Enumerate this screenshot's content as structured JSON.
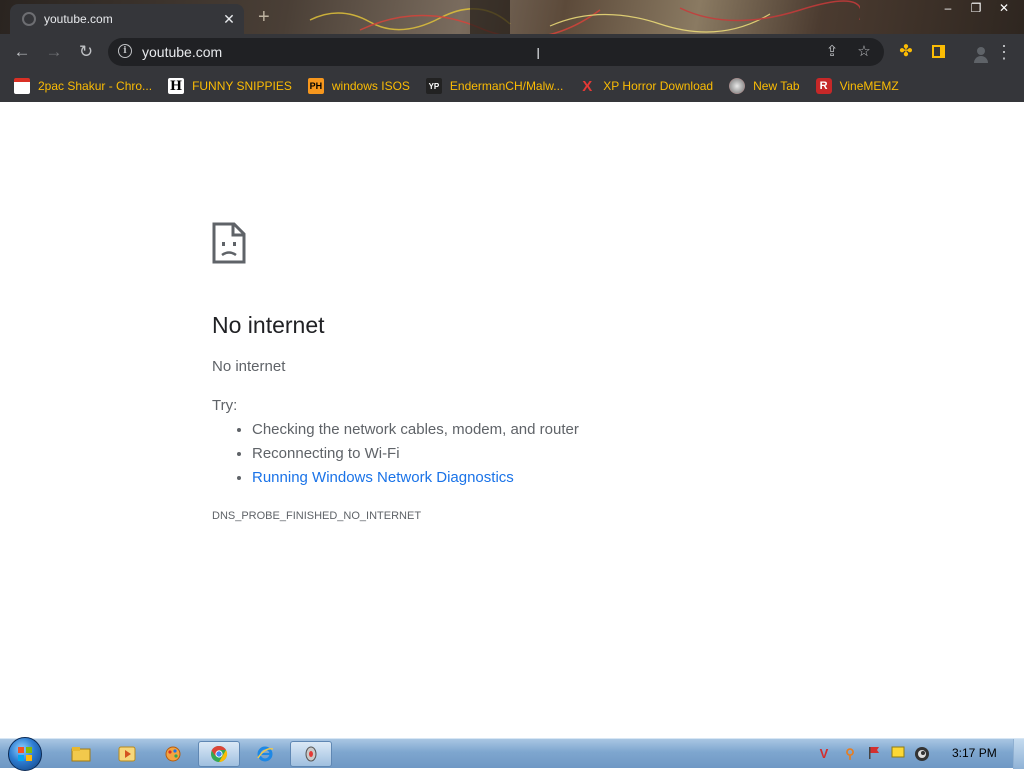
{
  "window": {
    "minimize_glyph": "–",
    "restore_glyph": "❐",
    "close_glyph": "✕"
  },
  "tab": {
    "title": "youtube.com",
    "close_glyph": "✕",
    "new_tab_glyph": "+"
  },
  "toolbar": {
    "back_glyph": "←",
    "forward_glyph": "→",
    "reload_glyph": "↻",
    "info_glyph": "i",
    "url": "youtube.com",
    "share_glyph": "⇪",
    "star_glyph": "☆",
    "extensions_glyph": "✤",
    "menu_glyph": "⋮",
    "cursor_glyph": "I"
  },
  "bookmarks": [
    {
      "label": "2pac Shakur - Chro...",
      "icon": "calendar-icon"
    },
    {
      "label": "FUNNY SNIPPIES",
      "icon": "h-icon",
      "glyph": "H"
    },
    {
      "label": "windows ISOS",
      "icon": "ph-icon",
      "glyph": "PH"
    },
    {
      "label": "EndermanCH/Malw...",
      "icon": "yp-icon",
      "glyph": "YP"
    },
    {
      "label": "XP Horror Download",
      "icon": "x-icon",
      "glyph": "X"
    },
    {
      "label": "New Tab",
      "icon": "globe-icon"
    },
    {
      "label": "VineMEMZ",
      "icon": "r-icon",
      "glyph": "R"
    }
  ],
  "error_page": {
    "title": "No internet",
    "subtitle": "No internet",
    "try_label": "Try:",
    "suggestions": [
      "Checking the network cables, modem, and router",
      "Reconnecting to Wi-Fi",
      "Running Windows Network Diagnostics"
    ],
    "error_code": "DNS_PROBE_FINISHED_NO_INTERNET"
  },
  "taskbar": {
    "apps": [
      "file-explorer-icon",
      "media-player-icon",
      "paint-icon",
      "chrome-icon",
      "internet-explorer-icon",
      "generic-app-icon"
    ],
    "tray_glyphs": {
      "v": "V",
      "search": "⚲"
    },
    "clock": "3:17 PM"
  },
  "colors": {
    "chrome_dark": "#35363a",
    "omnibox": "#202124",
    "bookmark_text": "#fbbc04",
    "link": "#1a73e8",
    "taskbar": "#7ea6cf"
  }
}
